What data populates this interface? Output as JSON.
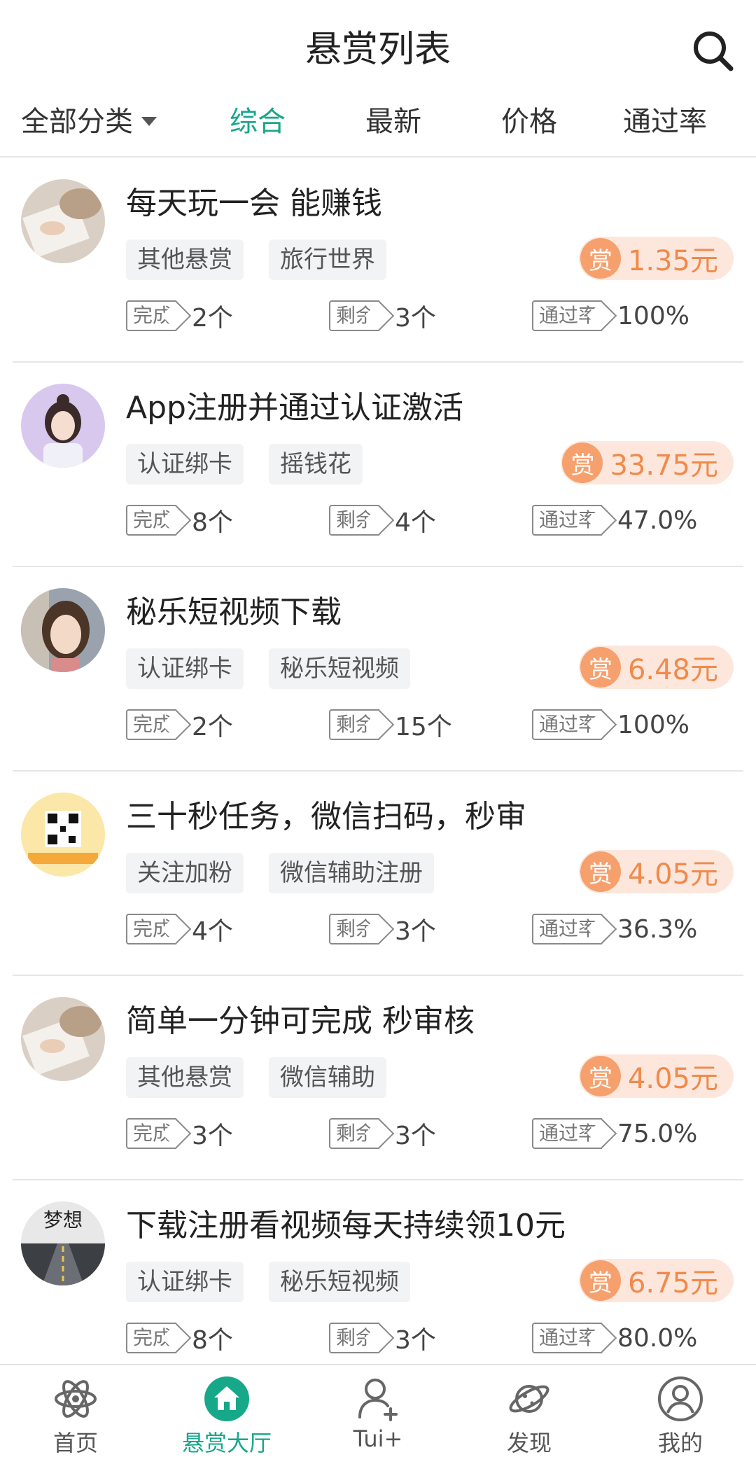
{
  "header": {
    "title": "悬赏列表"
  },
  "filters": {
    "category": "全部分类",
    "tabs": [
      "综合",
      "最新",
      "价格",
      "通过率"
    ]
  },
  "colors": {
    "accent": "#16a889",
    "reward": "#f08a4b",
    "reward_bg": "#fde7dc",
    "reward_badge": "#f6a06d"
  },
  "stat_labels": {
    "done": "完成",
    "remaining": "剩余",
    "pass_rate": "通过率"
  },
  "reward_badge": "赏",
  "tasks": [
    {
      "title": "每天玩一会 能赚钱",
      "tags": [
        "其他悬赏",
        "旅行世界"
      ],
      "reward": "1.35元",
      "done": "2个",
      "remaining": "3个",
      "pass_rate": "100%",
      "avatar": "hands-photo"
    },
    {
      "title": "App注册并通过认证激活",
      "tags": [
        "认证绑卡",
        "摇钱花"
      ],
      "reward": "33.75元",
      "done": "8个",
      "remaining": "4个",
      "pass_rate": "47.0%",
      "avatar": "girl-photo"
    },
    {
      "title": "秘乐短视频下载",
      "tags": [
        "认证绑卡",
        "秘乐短视频"
      ],
      "reward": "6.48元",
      "done": "2个",
      "remaining": "15个",
      "pass_rate": "100%",
      "avatar": "woman-selfie"
    },
    {
      "title": "三十秒任务，微信扫码，秒审",
      "tags": [
        "关注加粉",
        "微信辅助注册"
      ],
      "reward": "4.05元",
      "done": "4个",
      "remaining": "3个",
      "pass_rate": "36.3%",
      "avatar": "qr-poster"
    },
    {
      "title": "简单一分钟可完成 秒审核",
      "tags": [
        "其他悬赏",
        "微信辅助"
      ],
      "reward": "4.05元",
      "done": "3个",
      "remaining": "3个",
      "pass_rate": "75.0%",
      "avatar": "hands-photo"
    },
    {
      "title": "下载注册看视频每天持续领10元",
      "tags": [
        "认证绑卡",
        "秘乐短视频"
      ],
      "reward": "6.75元",
      "done": "8个",
      "remaining": "3个",
      "pass_rate": "80.0%",
      "avatar": "dream-road",
      "avatar_text": "梦想"
    }
  ],
  "nav": [
    {
      "label": "首页",
      "icon": "atom-icon"
    },
    {
      "label": "悬赏大厅",
      "icon": "home-icon",
      "active": true
    },
    {
      "label": "Tui+",
      "icon": "add-user-icon"
    },
    {
      "label": "发现",
      "icon": "planet-icon"
    },
    {
      "label": "我的",
      "icon": "profile-icon"
    }
  ]
}
